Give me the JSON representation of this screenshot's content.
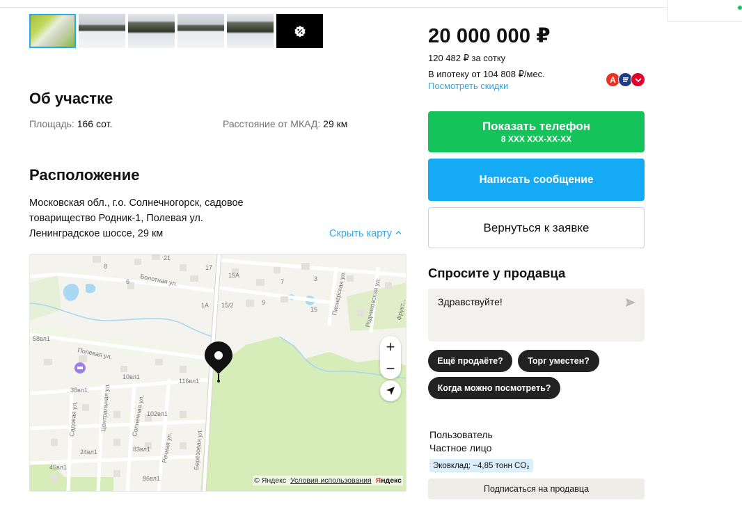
{
  "gallery": {
    "thumbnails": [
      {
        "kind": "plan-photo",
        "active": true
      },
      {
        "kind": "snow-field-photo",
        "active": false
      },
      {
        "kind": "snow-field-photo",
        "active": false
      },
      {
        "kind": "snow-field-photo",
        "active": false
      },
      {
        "kind": "snow-field-photo",
        "active": false
      },
      {
        "kind": "discount-badge-icon",
        "active": false
      }
    ]
  },
  "about": {
    "title": "Об участке",
    "area_label": "Площадь:",
    "area_value": "166 сот.",
    "mkad_label": "Расстояние от МКАД:",
    "mkad_value": "29 км"
  },
  "location": {
    "title": "Расположение",
    "address_line1": "Московская обл., г.о. Солнечногорск, садовое",
    "address_line2": "товарищество Родник-1, Полевая ул.",
    "address_line3": "Ленинградское шоссе, 29 км",
    "hide_map": "Скрыть карту",
    "hide_map_icon": "chevron-up-icon"
  },
  "map": {
    "labels": {
      "l21": "21",
      "l17": "17",
      "l8": "8",
      "l15a": "15А",
      "l7": "7",
      "l3": "3",
      "l6": "6",
      "l1a": "1А",
      "l152": "15/2",
      "l9": "9",
      "l15": "15",
      "bolotnaya": "Болотная ул.",
      "pionerskaya": "Пионерская ул.",
      "rodnikovskaya": "Родниковская ул.",
      "fruktovaya": "Фрукт...",
      "l58": "58вл1",
      "polevaya": "Полевая ул.",
      "l10": "10вл1",
      "l116": "116вл1",
      "l38": "38вл1",
      "centralnaya": "Центральная ул.",
      "solnechnaya": "Солнечная ул.",
      "sadovaya": "Садовая ул.",
      "l102": "102вл1",
      "l83": "83вл1",
      "rechnaya": "Речная ул.",
      "l24": "24вл1",
      "berezovaya": "Берёзовая ул.",
      "l45": "45вл1",
      "l86": "86вл1"
    },
    "zoom_in": "+",
    "zoom_out": "−",
    "copyright": "© Яндекс",
    "terms": "Условия использования",
    "logo_y": "Я",
    "logo_rest": "ндекс"
  },
  "pricing": {
    "price": "20 000 000 ₽",
    "per_sotka": "120 482 ₽ за сотку",
    "mortgage": "В ипотеку от 104 808 ₽/мес.",
    "discounts_link": "Посмотреть скидки",
    "bank_a": "А",
    "bank_colors": [
      "#ef3124",
      "#1f3c88",
      "#e4002b"
    ]
  },
  "actions": {
    "show_phone": "Показать телефон",
    "phone_masked": "8 XXX XXX-XX-XX",
    "write_message": "Написать сообщение",
    "back_to_request": "Вернуться к заявке"
  },
  "ask_seller": {
    "title": "Спросите у продавца",
    "message": "Здравствуйте!",
    "chips": [
      "Ещё продаёте?",
      "Торг уместен?",
      "Когда можно посмотреть?"
    ]
  },
  "seller": {
    "role": "Пользователь",
    "type": "Частное лицо",
    "eco": "Эковклад: −4,85 тонн CO₂",
    "subscribe": "Подписаться на продавца"
  },
  "colors": {
    "green": "#14c45a",
    "blue": "#14aaf5",
    "link": "#2fa8e8",
    "chip": "#222222"
  }
}
